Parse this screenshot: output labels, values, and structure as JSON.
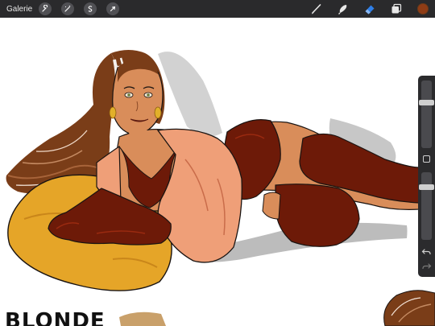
{
  "toolbar": {
    "gallery_label": "Galerie",
    "left_tools": [
      {
        "icon": "wrench-icon",
        "name": "actions-tool"
      },
      {
        "icon": "magic-wand-icon",
        "name": "adjustments-tool"
      },
      {
        "icon": "selection-s-icon",
        "name": "selection-tool"
      },
      {
        "icon": "cursor-arrow-icon",
        "name": "transform-tool"
      }
    ],
    "right_tools": [
      {
        "icon": "brush-icon",
        "name": "brush-tool",
        "active": false
      },
      {
        "icon": "smudge-icon",
        "name": "smudge-tool",
        "active": false
      },
      {
        "icon": "eraser-icon",
        "name": "eraser-tool",
        "active": true
      },
      {
        "icon": "layers-icon",
        "name": "layers-button",
        "active": false
      }
    ],
    "active_color": "#8f3c15"
  },
  "sidebar": {
    "brush_size_level": 0.28,
    "opacity_level": 0.18,
    "undo_icon": "undo-icon",
    "redo_icon": "redo-icon"
  },
  "canvas": {
    "partial_text": "BLONDE",
    "colors": {
      "skin": "#d98d5a",
      "hair": "#7a3d18",
      "shirt": "#ef9f78",
      "pillow": "#e5a528",
      "stockings": "#6d1a08",
      "outline": "#1a1412"
    }
  }
}
